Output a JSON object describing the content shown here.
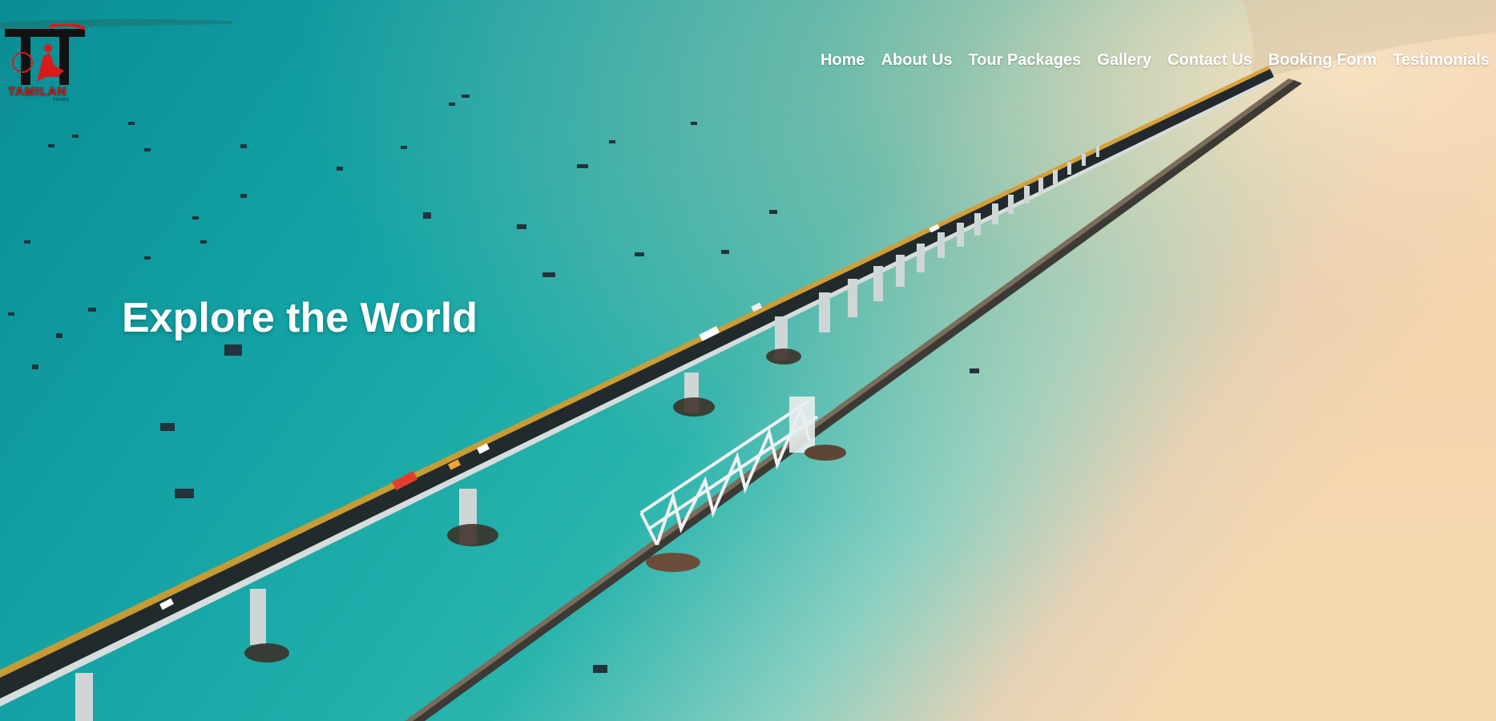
{
  "brand": {
    "logo_initials": "TT",
    "logo_name": "TAMILAN",
    "logo_subtitle": "TOURS",
    "colors": {
      "logo_red": "#d71b1b",
      "logo_black": "#111111"
    }
  },
  "nav": {
    "items": [
      {
        "label": "Home"
      },
      {
        "label": "About Us"
      },
      {
        "label": "Tour Packages"
      },
      {
        "label": "Gallery"
      },
      {
        "label": "Contact Us"
      },
      {
        "label": "Booking Form"
      },
      {
        "label": "Testimonials"
      }
    ]
  },
  "hero": {
    "headline": "Explore the World",
    "image_subject": "aerial view of a long sea bridge and a railway bridge over turquoise water with boats",
    "colors": {
      "sea": "#14a3a4",
      "sky_glow": "#f5d9b0",
      "text": "#ffffff"
    }
  }
}
